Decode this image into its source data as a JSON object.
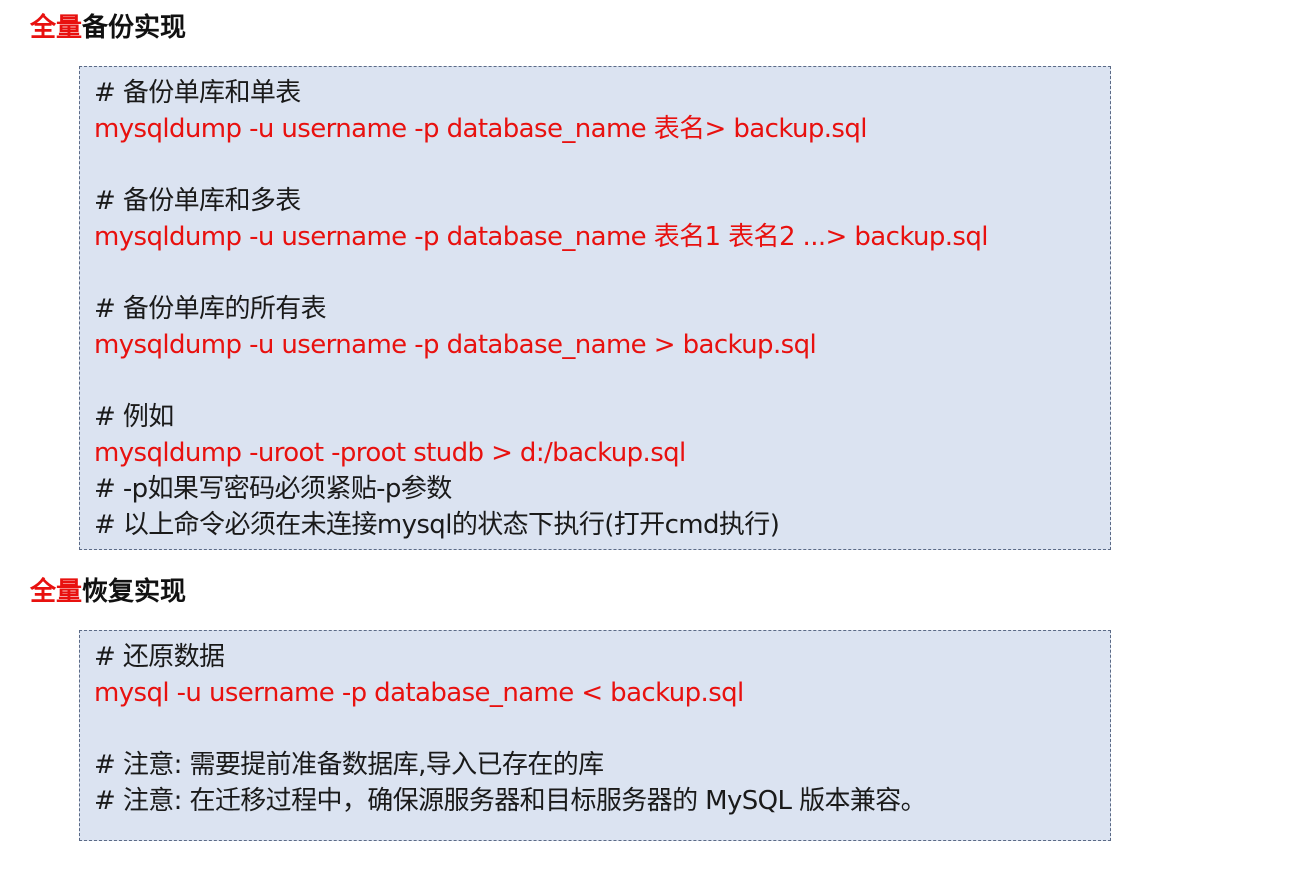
{
  "sections": [
    {
      "heading_hl": "全量",
      "heading_rest": "备份实现",
      "lines": [
        {
          "type": "comment",
          "text": "# 备份单库和单表"
        },
        {
          "type": "cmd",
          "text": "mysqldump -u username -p database_name  表名> backup.sql"
        },
        {
          "type": "blank",
          "text": ""
        },
        {
          "type": "comment",
          "text": "# 备份单库和多表"
        },
        {
          "type": "cmd",
          "text": "mysqldump -u username -p database_name  表名1 表名2 ...> backup.sql"
        },
        {
          "type": "blank",
          "text": ""
        },
        {
          "type": "comment",
          "text": "# 备份单库的所有表"
        },
        {
          "type": "cmd",
          "text": "mysqldump -u username -p database_name > backup.sql"
        },
        {
          "type": "blank",
          "text": ""
        },
        {
          "type": "comment",
          "text": "# 例如"
        },
        {
          "type": "cmd",
          "text": "mysqldump -uroot -proot studb > d:/backup.sql"
        },
        {
          "type": "comment",
          "text": "# -p如果写密码必须紧贴-p参数"
        },
        {
          "type": "comment",
          "text": "# 以上命令必须在未连接mysql的状态下执行(打开cmd执行)"
        }
      ]
    },
    {
      "heading_hl": "全量",
      "heading_rest": "恢复实现",
      "lines": [
        {
          "type": "comment",
          "text": "# 还原数据"
        },
        {
          "type": "cmd",
          "text": "mysql -u username -p database_name < backup.sql"
        },
        {
          "type": "blank",
          "text": ""
        },
        {
          "type": "comment",
          "text": "# 注意: 需要提前准备数据库,导入已存在的库"
        },
        {
          "type": "comment",
          "text": "# 注意: 在迁移过程中，确保源服务器和目标服务器的 MySQL 版本兼容。"
        }
      ]
    }
  ]
}
